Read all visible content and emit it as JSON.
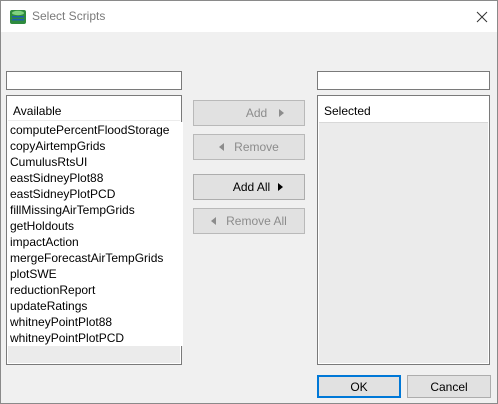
{
  "window": {
    "title": "Select Scripts",
    "icon": "app-icon",
    "close_icon": "close-icon"
  },
  "available": {
    "filter_value": "",
    "header": "Available",
    "items": [
      "computePercentFloodStorage",
      "copyAirtempGrids",
      "CumulusRtsUI",
      "eastSidneyPlot88",
      "eastSidneyPlotPCD",
      "fillMissingAirTempGrids",
      "getHoldouts",
      "impactAction",
      "mergeForecastAirTempGrids",
      "plotSWE",
      "reductionReport",
      "updateRatings",
      "whitneyPointPlot88",
      "whitneyPointPlotPCD"
    ]
  },
  "selected": {
    "filter_value": "",
    "header": "Selected",
    "items": []
  },
  "buttons": {
    "add": "Add",
    "remove": "Remove",
    "add_all": "Add All",
    "remove_all": "Remove All",
    "ok": "OK",
    "cancel": "Cancel"
  },
  "colors": {
    "title_text": "#7a7a7a",
    "default_button_border": "#0078d7",
    "disabled_text": "#8c8c8c"
  }
}
